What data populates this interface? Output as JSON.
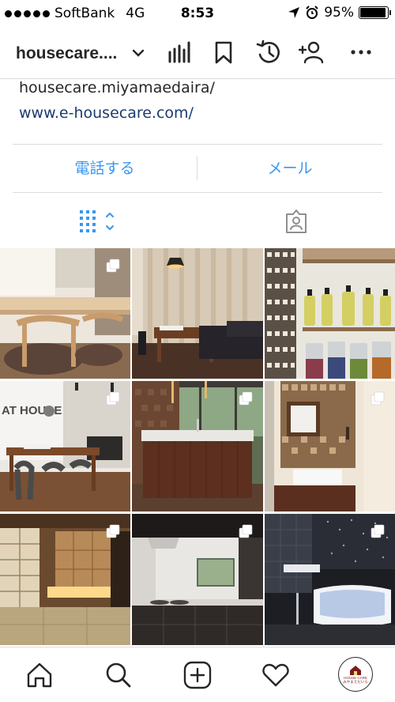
{
  "status_bar": {
    "carrier": "SoftBank",
    "network": "4G",
    "time": "8:53",
    "battery_percent": "95%",
    "battery_level": 0.95
  },
  "nav": {
    "username": "housecare...."
  },
  "bio": {
    "text": "housecare.miyamaedaira/",
    "link": "www.e-housecare.com/"
  },
  "contact": {
    "call_label": "電話する",
    "email_label": "メール"
  },
  "tabs": {
    "active": "grid",
    "items": [
      "grid",
      "tagged"
    ]
  },
  "icons": {
    "nav": [
      "chevron-down-icon",
      "insights-icon",
      "bookmark-icon",
      "archive-icon",
      "add-person-icon",
      "more-icon"
    ],
    "tab_bar": [
      "home-icon",
      "search-icon",
      "new-post-icon",
      "activity-icon",
      "profile-avatar"
    ]
  },
  "posts": [
    {
      "subject": "dining room",
      "multiple": true
    },
    {
      "subject": "living room",
      "multiple": false
    },
    {
      "subject": "kitchen shelves",
      "multiple": false
    },
    {
      "subject": "showroom",
      "multiple": true
    },
    {
      "subject": "kitchen island",
      "multiple": true
    },
    {
      "subject": "vanity",
      "multiple": true
    },
    {
      "subject": "tatami room",
      "multiple": true
    },
    {
      "subject": "kitchen",
      "multiple": true
    },
    {
      "subject": "bathroom",
      "multiple": true
    }
  ],
  "profile_logo": {
    "line1": "HOUSE CARE",
    "line2": "みやまえだいら"
  },
  "colors": {
    "accent": "#3897f0",
    "link": "#1a3b6e",
    "divider": "#dbdbdb",
    "text": "#262626"
  }
}
